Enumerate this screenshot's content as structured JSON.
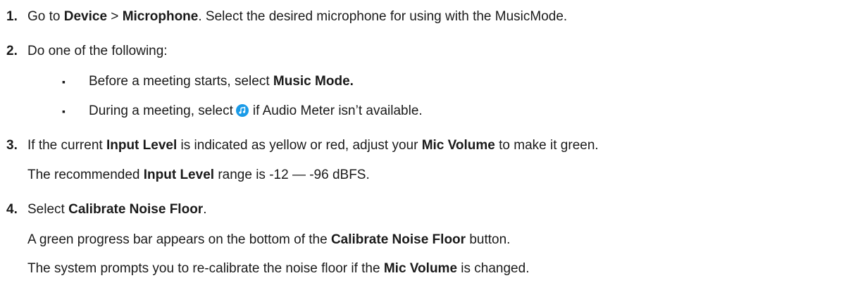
{
  "steps": [
    {
      "number": "1.",
      "prefix": "Go to ",
      "b1": "Device",
      "sep": " > ",
      "b2": "Microphone",
      "suffix": ". Select the desired microphone for using with the MusicMode."
    },
    {
      "number": "2.",
      "text": "Do one of the following:",
      "bullets": [
        {
          "marker": "▪",
          "prefix": "Before a meeting starts, select ",
          "bold": "Music Mode."
        },
        {
          "marker": "▪",
          "prefix": "During a meeting, select",
          "icon": "music-note-icon",
          "suffix": "if Audio Meter isn’t available."
        }
      ]
    },
    {
      "number": "3.",
      "l1_prefix": "If the current ",
      "l1_b1": "Input Level",
      "l1_mid": " is indicated as yellow or red, adjust your ",
      "l1_b2": "Mic Volume",
      "l1_suffix": " to make it green.",
      "l2_prefix": "The recommended ",
      "l2_b": "Input Level",
      "l2_suffix": " range is -12 — -96 dBFS."
    },
    {
      "number": "4.",
      "l1_prefix": "Select ",
      "l1_b": "Calibrate Noise Floor",
      "l1_suffix": ".",
      "l2_prefix": "A green progress bar appears on the bottom of the ",
      "l2_b": "Calibrate Noise Floor",
      "l2_suffix": " button.",
      "l3_prefix": "The system prompts you to re-calibrate the noise floor if the ",
      "l3_b": "Mic Volume",
      "l3_suffix": " is changed."
    }
  ],
  "colors": {
    "text": "#1a1a1a",
    "icon": "#1a9be8"
  }
}
